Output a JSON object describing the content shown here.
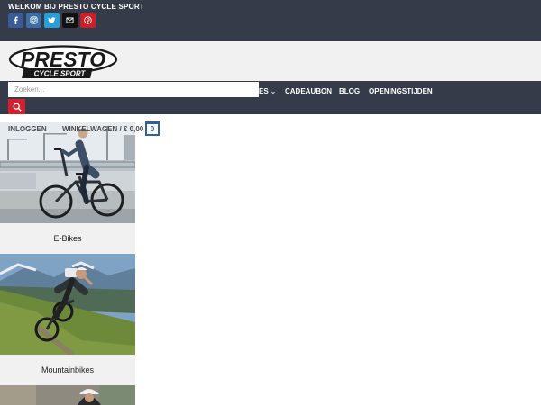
{
  "topbar": {
    "welcome": "WELKOM BIJ PRESTO CYCLE SPORT",
    "social": [
      {
        "name": "facebook-icon",
        "color": "#3a5a98"
      },
      {
        "name": "instagram-icon",
        "color": "#3a6ea5"
      },
      {
        "name": "twitter-icon",
        "color": "#2a9fd6"
      },
      {
        "name": "email-icon",
        "color": "#111111"
      },
      {
        "name": "pinterest-icon",
        "color": "#cb2027"
      }
    ]
  },
  "logo": {
    "line1": "PRESTO",
    "line2": "CYCLE SPORT"
  },
  "search": {
    "placeholder": "Zoeken..."
  },
  "nav": {
    "partial_item": "ES",
    "items": [
      "CADEAUBON",
      "BLOG",
      "OPENINGSTIJDEN"
    ]
  },
  "account": {
    "login": "INLOGGEN",
    "cart_label": "WINKELWAGEN / € 0,00",
    "cart_count": "0"
  },
  "categories": [
    {
      "label": "E-Bikes"
    },
    {
      "label": "Mountainbikes"
    },
    {
      "label": ""
    }
  ],
  "colors": {
    "dark_bar": "#353b48",
    "accent_red": "#d3212f",
    "cart_blue": "#2e5f9e"
  }
}
